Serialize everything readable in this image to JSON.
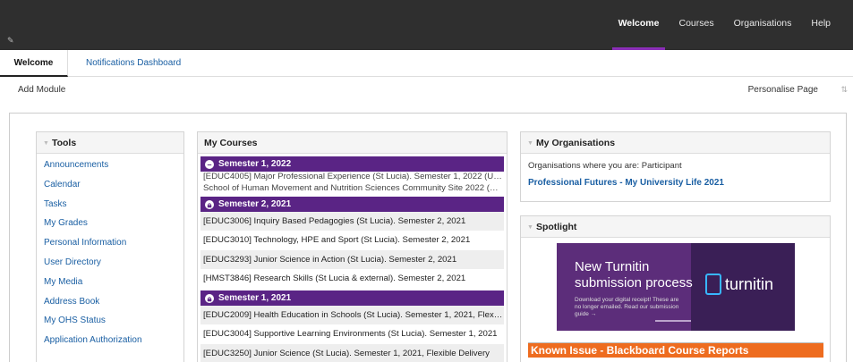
{
  "topbar": {
    "nav": [
      {
        "label": "Welcome",
        "active": true
      },
      {
        "label": "Courses"
      },
      {
        "label": "Organisations"
      },
      {
        "label": "Help"
      }
    ]
  },
  "subtabs": {
    "welcome": "Welcome",
    "notifications": "Notifications Dashboard"
  },
  "actionbar": {
    "add_module": "Add Module",
    "personalise": "Personalise Page"
  },
  "tools": {
    "title": "Tools",
    "items": [
      "Announcements",
      "Calendar",
      "Tasks",
      "My Grades",
      "Personal Information",
      "User Directory",
      "My Media",
      "Address Book",
      "My OHS Status",
      "Application Authorization"
    ]
  },
  "courses": {
    "title": "My Courses",
    "sem1_2022": "Semester 1, 2022",
    "sem1_2022_rows": [
      "[EDUC4005] Major Professional Experience (St Lucia). Semester 1, 2022 (Unavailabl",
      "School of Human Movement and Nutrition Sciences Community Site 2022 (Unavail"
    ],
    "sem2_2021": "Semester 2, 2021",
    "sem2_2021_rows": [
      "[EDUC3006] Inquiry Based Pedagogies (St Lucia). Semester 2, 2021",
      "[EDUC3010] Technology, HPE and Sport (St Lucia). Semester 2, 2021",
      "[EDUC3293] Junior Science in Action (St Lucia). Semester 2, 2021",
      "[HMST3846] Research Skills (St Lucia & external). Semester 2, 2021"
    ],
    "sem1_2021": "Semester 1, 2021",
    "sem1_2021_rows": [
      "[EDUC2009] Health Education in Schools (St Lucia). Semester 1, 2021, Flexible D...",
      "[EDUC3004] Supportive Learning Environments (St Lucia). Semester 1, 2021",
      "[EDUC3250] Junior Science (St Lucia). Semester 1, 2021, Flexible Delivery"
    ]
  },
  "orgs": {
    "title": "My Organisations",
    "note": "Organisations where you are: Participant",
    "link": "Professional Futures - My University Life 2021"
  },
  "spotlight": {
    "title": "Spotlight",
    "banner_title": "New Turnitin submission process",
    "banner_sub": "Download your digital receipt! These are no longer emailed. Read our submission guide →",
    "banner_logo": "turnitin",
    "known_issue": "Known Issue - Blackboard Course Reports"
  },
  "colors": {
    "topbar": "#2f2f2f",
    "accent": "#8b2fb8",
    "semester_header": "#5a2485",
    "link": "#1a5fa3",
    "known_issue": "#ee6c1f"
  }
}
